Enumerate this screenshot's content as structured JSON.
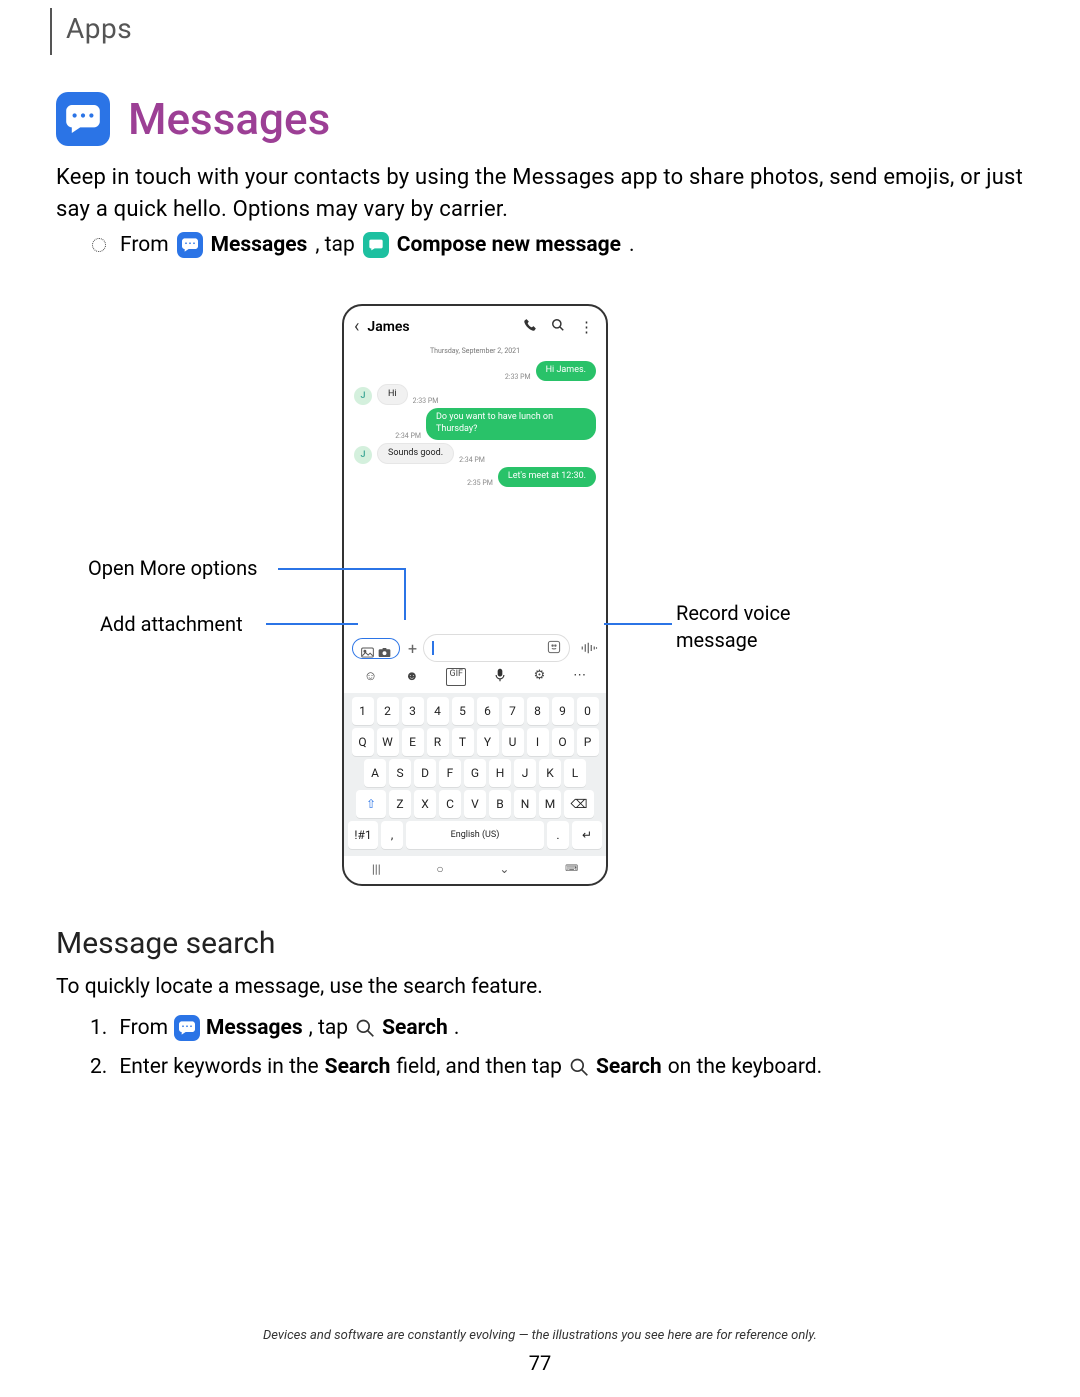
{
  "tab": "Apps",
  "title": "Messages",
  "intro": "Keep in touch with your contacts by using the Messages app to share photos, send emojis, or just say a quick hello. Options may vary by carrier.",
  "step1": {
    "from": "From",
    "messages": "Messages",
    "tap": ", tap",
    "compose": "Compose new message",
    "period": "."
  },
  "phone": {
    "contact": "James",
    "date": "Thursday, September 2, 2021",
    "thread": [
      {
        "side": "right",
        "time": "2:33 PM",
        "text": "Hi James."
      },
      {
        "side": "left",
        "time": "2:33 PM",
        "text": "Hi",
        "avatar": "J"
      },
      {
        "side": "right",
        "time": "2:34 PM",
        "text": "Do you want to have lunch on Thursday?"
      },
      {
        "side": "left",
        "time": "2:34 PM",
        "text": "Sounds good.",
        "avatar": "J"
      },
      {
        "side": "right",
        "time": "2:35 PM",
        "text": "Let's meet at 12:30."
      }
    ],
    "keyboard": {
      "row_num": [
        "1",
        "2",
        "3",
        "4",
        "5",
        "6",
        "7",
        "8",
        "9",
        "0"
      ],
      "row_q": [
        "Q",
        "W",
        "E",
        "R",
        "T",
        "Y",
        "U",
        "I",
        "O",
        "P"
      ],
      "row_a": [
        "A",
        "S",
        "D",
        "F",
        "G",
        "H",
        "J",
        "K",
        "L"
      ],
      "row_z": [
        "Z",
        "X",
        "C",
        "V",
        "B",
        "N",
        "M"
      ],
      "sym": "!#1",
      "lang": "English (US)"
    }
  },
  "callouts": {
    "open_more": "Open More options",
    "add_attachment": "Add attachment",
    "record_voice": "Record voice message"
  },
  "section2": {
    "heading": "Message search",
    "desc": "To quickly locate a message, use the search feature.",
    "step1_num": "1.",
    "step1_from": "From",
    "step1_messages": "Messages",
    "step1_tap": ", tap",
    "step1_search": "Search",
    "step1_period": ".",
    "step2_num": "2.",
    "step2_a": "Enter keywords in the ",
    "step2_searchfield": "Search",
    "step2_b": " field, and then tap ",
    "step2_search2": "Search",
    "step2_c": " on the keyboard."
  },
  "footer": "Devices and software are constantly evolving — the illustrations you see here are for reference only.",
  "page": "77"
}
